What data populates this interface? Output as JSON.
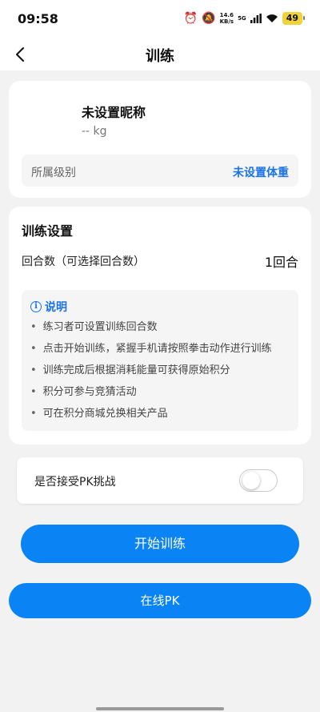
{
  "status_bar": {
    "time": "09:58",
    "net_speed_value": "14.6",
    "net_speed_unit": "KB/s",
    "network_generation": "5G",
    "battery": "49"
  },
  "nav": {
    "title": "训练"
  },
  "profile": {
    "nickname": "未设置昵称",
    "weight": "-- kg",
    "level_label": "所属级别",
    "level_action": "未设置体重"
  },
  "settings": {
    "title": "训练设置",
    "rounds_label": "回合数（可选择回合数）",
    "rounds_value": "1回合",
    "info_title": "说明",
    "info_items": [
      "练习者可设置训练回合数",
      "点击开始训练，紧握手机请按照拳击动作进行训练",
      "训练完成后根据消耗能量可获得原始积分",
      "积分可参与竞猜活动",
      "可在积分商城兑换相关产品"
    ]
  },
  "pk": {
    "accept_label": "是否接受PK挑战",
    "accept_enabled": false
  },
  "buttons": {
    "start_training": "开始训练",
    "online_pk": "在线PK"
  },
  "colors": {
    "accent": "#0a84f5",
    "link": "#1a73e8",
    "battery": "#f0d23a"
  }
}
